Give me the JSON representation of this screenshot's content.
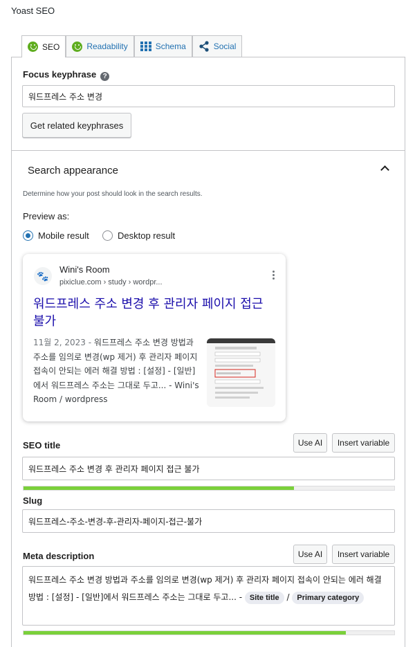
{
  "plugin_title": "Yoast SEO",
  "tabs": [
    {
      "label": "SEO",
      "icon": "smiley-good-icon",
      "active": true
    },
    {
      "label": "Readability",
      "icon": "smiley-good-icon",
      "active": false
    },
    {
      "label": "Schema",
      "icon": "grid-icon",
      "active": false
    },
    {
      "label": "Social",
      "icon": "share-icon",
      "active": false
    }
  ],
  "focus": {
    "label": "Focus keyphrase",
    "value": "워드프레스 주소 변경",
    "related_button": "Get related keyphrases"
  },
  "search_appearance": {
    "title": "Search appearance",
    "description": "Determine how your post should look in the search results.",
    "preview_as": "Preview as:",
    "mobile_label": "Mobile result",
    "desktop_label": "Desktop result",
    "selected": "mobile"
  },
  "serp": {
    "site_name": "Wini's Room",
    "url": "pixiclue.com › study › wordpr...",
    "title": "워드프레스 주소 변경 후 관리자 페이지 접근 불가",
    "date": "11월 2, 2023  -",
    "description": "워드프레스 주소 변경 방법과 주소를 임의로 변경(wp 제거) 후 관리자 페이지 접속이 안되는 에러 해결 방법 : [설정] - [일반]에서 워드프레스 주소는 그대로 두고... - Wini's Room / wordpress"
  },
  "seo_title": {
    "label": "SEO title",
    "use_ai": "Use AI",
    "insert_variable": "Insert variable",
    "value": "워드프레스 주소 변경 후 관리자 페이지 접근 불가",
    "progress": 0.73
  },
  "slug": {
    "label": "Slug",
    "value": "워드프레스-주소-변경-후-관리자-페이지-접근-불가"
  },
  "meta": {
    "label": "Meta description",
    "use_ai": "Use AI",
    "insert_variable": "Insert variable",
    "text": "워드프레스 주소 변경 방법과 주소를 임의로 변경(wp 제거) 후 관리자 페이지 접속이 안되는 에러 해결 방법 : [설정] - [일반]에서 워드프레스 주소는 그대로 두고... -",
    "site_title_pill": "Site title",
    "separator": "/",
    "category_pill": "Primary category",
    "progress": 0.87
  },
  "colors": {
    "link": "#2271b1",
    "serp_link": "#1a0dab",
    "good": "#7ad03a"
  }
}
